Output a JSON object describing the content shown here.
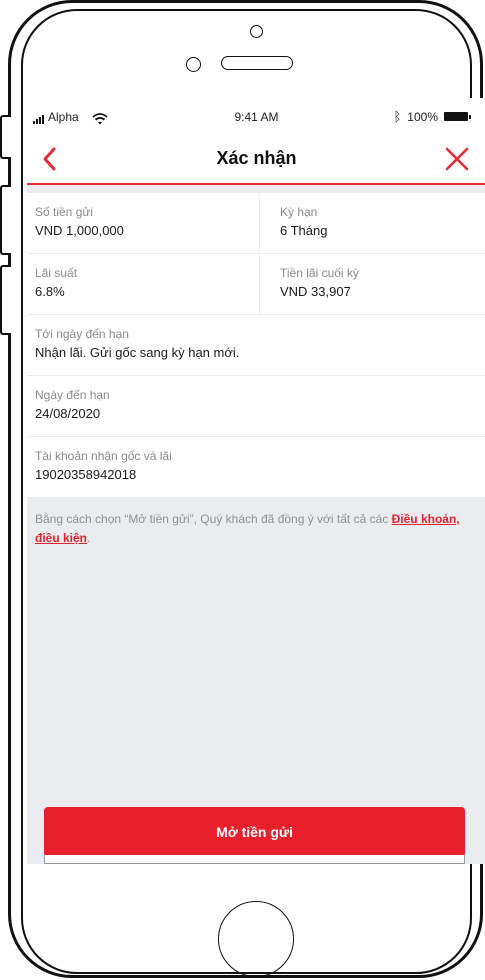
{
  "status_bar": {
    "carrier": "Alpha",
    "time": "9:41 AM",
    "battery": "100%"
  },
  "header": {
    "title": "Xác nhận"
  },
  "details": {
    "deposit_amount": {
      "label": "Số tiền gửi",
      "value": "VND 1,000,000"
    },
    "term": {
      "label": "Kỳ hạn",
      "value": "6 Tháng"
    },
    "interest_rate": {
      "label": "Lãi suất",
      "value": "6.8%"
    },
    "final_interest": {
      "label": "Tiền lãi cuối kỳ",
      "value": "VND 33,907"
    },
    "maturity_instruction": {
      "label": "Tới ngày đến hạn",
      "value": "Nhận lãi. Gửi gốc sang kỳ hạn mới."
    },
    "maturity_date": {
      "label": "Ngày đến hạn",
      "value": "24/08/2020"
    },
    "receiving_account": {
      "label": "Tài khoản nhận gốc và lãi",
      "value": "19020358942018"
    }
  },
  "consent": {
    "text": "Bằng cách chọn “Mở tiền gửi”, Quý khách đã đồng ý với tất cả các ",
    "link": "Điều khoản, điều kiện",
    "suffix": "."
  },
  "actions": {
    "open_deposit": "Mở tiền gửi"
  },
  "colors": {
    "accent": "#e8202b",
    "background": "#eaedf0"
  },
  "icons": {
    "back": "chevron-left-icon",
    "close": "close-icon",
    "wifi": "wifi-icon",
    "bluetooth": "bluetooth-icon"
  }
}
